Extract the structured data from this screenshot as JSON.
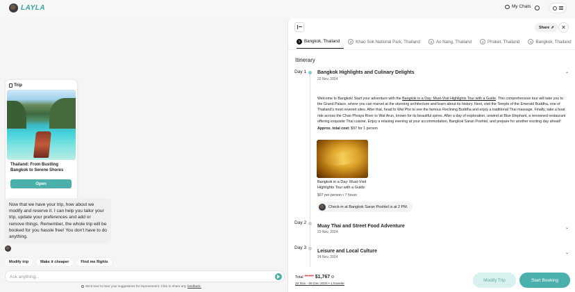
{
  "header": {
    "brand": "LAYLA",
    "my_chats_label": "My Chats",
    "icons": [
      "avatar",
      "chat-icon",
      "globe-icon",
      "user-icon",
      "hamburger-icon"
    ]
  },
  "chat": {
    "trip_card": {
      "title": "Trip",
      "caption": "Thailand: From Bustling Bangkok to Serene Shores",
      "open_label": "Open"
    },
    "assistant_message": "Now that we have your trip, how about we modify and reserve it. I can help you tailor your trip, update your preferences and add or remove things. Remember, the whole trip will be booked for you hassle free! You don't have to do anything.",
    "suggestions": [
      "Modify trip",
      "Make it cheaper",
      "Find me flights"
    ],
    "input_placeholder": "Ask anything...",
    "feedback_text": "We'd love to hear your suggestions for improvement. Click to share any",
    "feedback_link": "feedback."
  },
  "panel": {
    "share_label": "Share",
    "tabs": [
      {
        "num": "1",
        "label": "Bangkok, Thailand"
      },
      {
        "num": "2",
        "label": "Khao Sok National Park, Thailand"
      },
      {
        "num": "3",
        "label": "Ao Nang, Thailand"
      },
      {
        "num": "4",
        "label": "Phuket, Thailand"
      },
      {
        "num": "5",
        "label": "Bangkok, Thailand"
      }
    ],
    "itinerary_title": "Itinerary",
    "days": [
      {
        "label": "Day 1",
        "title": "Bangkok Highlights and Culinary Delights",
        "date": "22 Nov, 2024"
      },
      {
        "label": "Day 2",
        "title": "Muay Thai and Street Food Adventure",
        "date": "23 Nov, 2024"
      },
      {
        "label": "Day 3",
        "title": "Leisure and Local Culture",
        "date": "24 Nov, 2024"
      }
    ],
    "day1": {
      "desc_prefix": "Welcome to Bangkok! Start your adventure with the ",
      "desc_link": "Bangkok in a Day: Must-Visit Highlights Tour with a Guide",
      "desc_suffix": ". This comprehensive tour will take you to the Grand Palace, where you can marvel at the stunning architecture and learn about its history. Next, visit the Temple of the Emerald Buddha, one of Thailand's most revered sites. After that, head to Wat Pho to see the famous Reclining Buddha and enjoy a traditional Thai massage. Finally, take a boat ride across the Chao Phraya River to Wat Arun, known for its beautiful spires. After a day of exploration, unwind at Blue Elephant, a renowned restaurant offering exquisite Thai cuisine. Enjoy a relaxing evening at your accommodation, Bangkok Saran Poshtel, and prepare for another exciting day ahead!",
      "cost_label": "Approx. total cost:",
      "cost_value": "$97 for 1 person",
      "activity_name": "Bangkok in a Day: Must-Visit Highlights Tour with a Guide",
      "activity_meta": "$97 per person • 7 hours",
      "checkin": "Check-in at Bangkok Saran Poshtel is at 2 PM."
    },
    "footer": {
      "total_label": "Total",
      "old_price": "$1,817",
      "new_price": "$1,767",
      "dates": "22 Nov - 06 Dec 2024 • 1 traveler",
      "modify_label": "Modify Trip",
      "start_label": "Start Booking"
    }
  },
  "colors": {
    "accent": "#4bb0ac",
    "accent_light": "#d9f1ee",
    "price_strike": "#e25a5a"
  }
}
